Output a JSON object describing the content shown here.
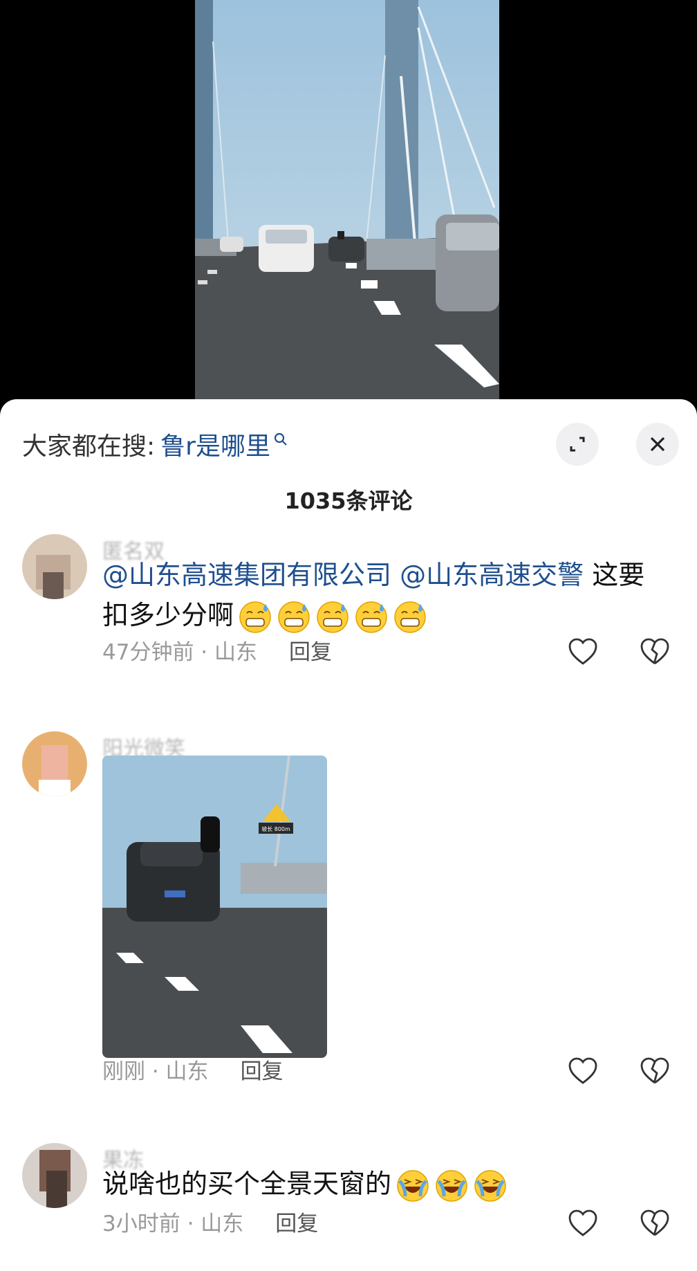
{
  "search": {
    "prefix": "大家都在搜:",
    "term": "鲁r是哪里"
  },
  "comments_header": {
    "count_label": "1035条评论"
  },
  "comments": [
    {
      "username": "匿名双",
      "mentions": [
        "@山东高速集团有限公司",
        "@山东高速交警"
      ],
      "text": "这要扣多少分啊",
      "emoji_count": 5,
      "emoji_name": "cold-sweat-grin-emoji",
      "time": "47分钟前 · 山东",
      "reply_label": "回复"
    },
    {
      "username": "阳光微笑",
      "image_sign_text": "坡长 800m",
      "time": "刚刚 · 山东",
      "reply_label": "回复"
    },
    {
      "username": "果冻",
      "text": "说啥也的买个全景天窗的",
      "emoji_count": 3,
      "emoji_name": "loudly-crying-laughing-emoji",
      "time": "3小时前 · 山东",
      "reply_label": "回复"
    }
  ],
  "colors": {
    "accent_link": "#1f4f8f",
    "meta_gray": "#999999",
    "sheet_bg": "#ffffff"
  },
  "icons": [
    "search-icon",
    "expand-icon",
    "close-icon",
    "heart-icon",
    "broken-heart-icon"
  ]
}
